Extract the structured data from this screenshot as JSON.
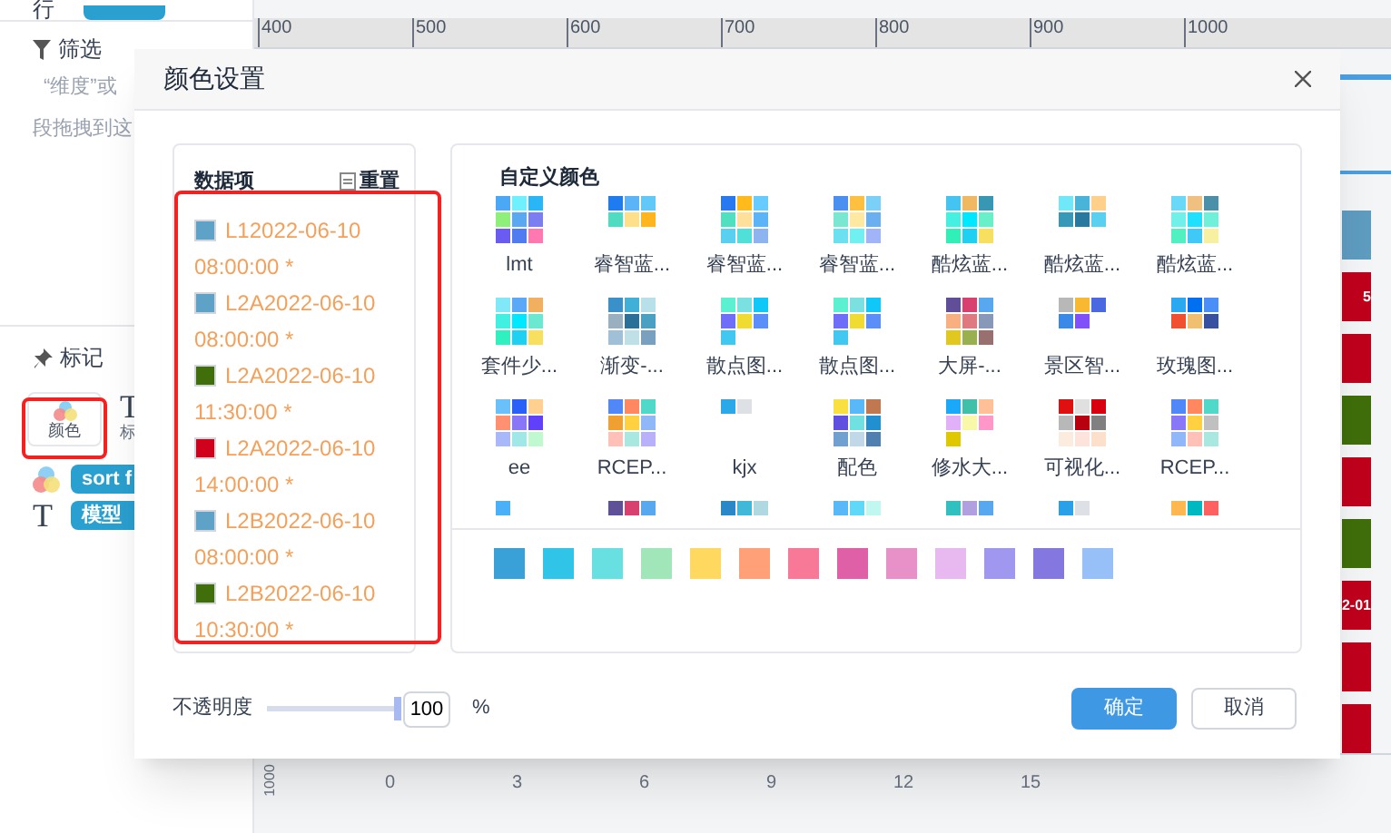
{
  "sidebar": {
    "row_label": "行",
    "filter_title": "筛选",
    "filter_hint_1": "“维度”或",
    "filter_hint_2": "段拖拽到这",
    "marks_title": "标记",
    "color_button": "颜色",
    "label_icon": "T",
    "label_button": "标",
    "mark_fields": [
      {
        "kind": "color",
        "tag": "sort f"
      },
      {
        "kind": "text",
        "icon": "T",
        "tag": "模型"
      }
    ]
  },
  "canvas": {
    "ruler": [
      "400",
      "500",
      "600",
      "700",
      "800",
      "900",
      "1000"
    ],
    "bar_texts": [
      "5",
      "2-01"
    ],
    "x_ticks": [
      "0",
      "3",
      "6",
      "9",
      "12",
      "15"
    ],
    "y_tick": "1000"
  },
  "dialog": {
    "title": "颜色设置",
    "data_items": {
      "title": "数据项",
      "reset": "重置",
      "items": [
        {
          "label": "L12022-06-10 08:00:00 *",
          "color": "#5ea2c8"
        },
        {
          "label": "L2A2022-06-10 08:00:00 *",
          "color": "#5ea2c8"
        },
        {
          "label": "L2A2022-06-10 11:30:00 *",
          "color": "#3f6e0a"
        },
        {
          "label": "L2A2022-06-10 14:00:00 *",
          "color": "#d0021b"
        },
        {
          "label": "L2B2022-06-10 08:00:00 *",
          "color": "#5ea2c8"
        },
        {
          "label": "L2B2022-06-10 10:30:00 *",
          "color": "#3f6e0a"
        }
      ]
    },
    "custom_colors": {
      "title": "自定义颜色",
      "palettes": [
        {
          "name": "lmt",
          "swatches": [
            {
              "color": "#4aa8f5"
            },
            {
              "color": "#6ff0ff"
            },
            {
              "color": "#29b6f6"
            },
            {
              "color": "#8ef07a"
            },
            {
              "color": "#5aa8f0"
            },
            {
              "color": "#7a7ef0"
            },
            {
              "color": "#6a5cf0"
            },
            {
              "color": "#4f7cf0"
            },
            {
              "color": "#ff78b0"
            }
          ]
        },
        {
          "name": "睿智蓝...",
          "swatches": [
            {
              "color": "#1e7cf0"
            },
            {
              "color": "#5ab4f7"
            },
            {
              "color": "#62c8f7"
            },
            {
              "color": "#4fdcc0"
            },
            {
              "color": "#ffe08a"
            },
            {
              "color": "#ffb51e"
            }
          ]
        },
        {
          "name": "睿智蓝...",
          "swatches": [
            {
              "color": "#2878f0"
            },
            {
              "color": "#ffbb1c"
            },
            {
              "color": "#66ccff"
            },
            {
              "color": "#50e0c0"
            },
            {
              "color": "#ffe09a"
            },
            {
              "color": "#5ab4f7"
            },
            {
              "color": "#5ad0f0"
            },
            {
              "color": "#50e0d8"
            },
            {
              "color": "#8eb4f0"
            }
          ]
        },
        {
          "name": "睿智蓝...",
          "swatches": [
            {
              "color": "#4a90f0"
            },
            {
              "color": "#ffc040"
            },
            {
              "color": "#7ad0f7"
            },
            {
              "color": "#7ae8d0"
            },
            {
              "color": "#ffe8a0"
            },
            {
              "color": "#6ab0f0"
            },
            {
              "color": "#6ae0f0"
            },
            {
              "color": "#70f0f0"
            },
            {
              "color": "#a0b4f7"
            }
          ]
        },
        {
          "name": "酷炫蓝...",
          "swatches": [
            {
              "color": "#44c4f0"
            },
            {
              "color": "#f0b860"
            },
            {
              "color": "#3898b4"
            },
            {
              "color": "#44f0e0"
            },
            {
              "color": "#00e8ff"
            },
            {
              "color": "#6af0c8"
            },
            {
              "color": "#30f0b8"
            },
            {
              "color": "#20d0f0"
            },
            {
              "color": "#f7e060"
            }
          ]
        },
        {
          "name": "酷炫蓝...",
          "swatches": [
            {
              "color": "#70e8f7"
            },
            {
              "color": "#4ab4d8"
            },
            {
              "color": "#ffd08a"
            },
            {
              "color": "#3898b8"
            },
            {
              "color": "#2878a0"
            },
            {
              "color": "#5ad0f0"
            }
          ]
        },
        {
          "name": "酷炫蓝...",
          "swatches": [
            {
              "color": "#6ad8f7"
            },
            {
              "color": "#f0c080"
            },
            {
              "color": "#4a90a8"
            },
            {
              "color": "#70f0e8"
            },
            {
              "color": "#20e0ff"
            },
            {
              "color": "#70f0d8"
            },
            {
              "color": "#50f0c0"
            },
            {
              "color": "#40c8f7"
            },
            {
              "color": "#f7f0a0"
            }
          ]
        },
        {
          "name": "套件少...",
          "swatches": [
            {
              "color": "#80e8f7"
            },
            {
              "color": "#5aa8f8"
            },
            {
              "color": "#f0b060"
            },
            {
              "color": "#40f0e0"
            },
            {
              "color": "#00e8ff"
            },
            {
              "color": "#6ae8d0"
            },
            {
              "color": "#30f0c0"
            },
            {
              "color": "#20d0f0"
            },
            {
              "color": "#f7e060"
            }
          ]
        },
        {
          "name": "渐变-...",
          "swatches": [
            {
              "color": "#3a90c8"
            },
            {
              "color": "#40b0d8"
            },
            {
              "color": "#b8e0e8"
            },
            {
              "color": "#98b0c0"
            },
            {
              "color": "#2a7098"
            },
            {
              "color": "#4aa0c0"
            },
            {
              "color": "#a0c0d8"
            },
            {
              "color": "#c0e0e8"
            },
            {
              "color": "#7aa0c0"
            }
          ]
        },
        {
          "name": "散点图...",
          "swatches": [
            {
              "color": "#5af0d0"
            },
            {
              "color": "#7ae0e0"
            },
            {
              "color": "#10c8f8"
            },
            {
              "color": "#6e6ef8"
            },
            {
              "color": "#f0dc30"
            },
            {
              "color": "#5a8ef8"
            },
            {
              "color": "#40c8f0"
            }
          ]
        },
        {
          "name": "散点图...",
          "swatches": [
            {
              "color": "#5af0d0"
            },
            {
              "color": "#7ae0e0"
            },
            {
              "color": "#10c8f8"
            },
            {
              "color": "#6e6ef8"
            },
            {
              "color": "#f0dc30"
            },
            {
              "color": "#5a8ef8"
            },
            {
              "color": "#40c8f0"
            }
          ]
        },
        {
          "name": "大屏-...",
          "swatches": [
            {
              "color": "#604f98"
            },
            {
              "color": "#d84070"
            },
            {
              "color": "#58a8f0"
            },
            {
              "color": "#f8b080"
            },
            {
              "color": "#e07880"
            },
            {
              "color": "#8898b8"
            },
            {
              "color": "#e0c820"
            },
            {
              "color": "#98b050"
            },
            {
              "color": "#987070"
            }
          ]
        },
        {
          "name": "景区智...",
          "swatches": [
            {
              "color": "#b8b8b8"
            },
            {
              "color": "#f8b830"
            },
            {
              "color": "#4a68e0"
            },
            {
              "color": "#3a88e8"
            },
            {
              "color": "#8050f8"
            }
          ]
        },
        {
          "name": "玫瑰图...",
          "swatches": [
            {
              "color": "#2aa8f0"
            },
            {
              "color": "#0070f0"
            },
            {
              "color": "#4a8ef8"
            },
            {
              "color": "#f05030"
            },
            {
              "color": "#f0c070"
            },
            {
              "color": "#3850a0"
            }
          ]
        },
        {
          "name": "ee",
          "swatches": [
            {
              "color": "#6ac0f8"
            },
            {
              "color": "#2860f8"
            },
            {
              "color": "#ffd090"
            },
            {
              "color": "#ff9070"
            },
            {
              "color": "#8878f8"
            },
            {
              "color": "#6040f8"
            },
            {
              "color": "#a8b8f8"
            },
            {
              "color": "#a0e8e8"
            },
            {
              "color": "#c0f8d0"
            }
          ]
        },
        {
          "name": "RCEP...",
          "swatches": [
            {
              "color": "#5088f8"
            },
            {
              "color": "#ff8860"
            },
            {
              "color": "#50d8c8"
            },
            {
              "color": "#f0a030"
            },
            {
              "color": "#ffd040"
            },
            {
              "color": "#90b8f8"
            },
            {
              "color": "#ffc0b8"
            },
            {
              "color": "#a8e8e0"
            },
            {
              "color": "#b8b0f8"
            }
          ]
        },
        {
          "name": "kjx",
          "swatches": [
            {
              "color": "#2aa8e8"
            },
            {
              "color": "#dde0e4"
            }
          ]
        },
        {
          "name": "配色",
          "swatches": [
            {
              "color": "#f7e040"
            },
            {
              "color": "#58b8f8"
            },
            {
              "color": "#c07850"
            },
            {
              "color": "#6050e0"
            },
            {
              "color": "#70e0e0"
            },
            {
              "color": "#2090d0"
            },
            {
              "color": "#70a0d0"
            },
            {
              "color": "#c0d8e8"
            },
            {
              "color": "#5080b0"
            }
          ]
        },
        {
          "name": "修水大...",
          "swatches": [
            {
              "color": "#1aa8f8"
            },
            {
              "color": "#40c0a8"
            },
            {
              "color": "#ffc098"
            },
            {
              "color": "#e0b0f8"
            },
            {
              "color": "#f8f8a8"
            },
            {
              "color": "#ff98c8"
            },
            {
              "color": "#e0c800"
            }
          ]
        },
        {
          "name": "可视化...",
          "swatches": [
            {
              "color": "#e01010"
            },
            {
              "color": "#e0e0e0"
            },
            {
              "color": "#d80010"
            },
            {
              "color": "#b8b8b8"
            },
            {
              "color": "#b80010"
            },
            {
              "color": "#808080"
            },
            {
              "color": "#fcece0"
            },
            {
              "color": "#fce4dc"
            },
            {
              "color": "#fce0cc"
            }
          ]
        },
        {
          "name": "RCEP...",
          "swatches": [
            {
              "color": "#5088f8"
            },
            {
              "color": "#ff8860"
            },
            {
              "color": "#50d8c8"
            },
            {
              "color": "#8878f8"
            },
            {
              "color": "#ffd040"
            },
            {
              "color": "#c0c0c0"
            },
            {
              "color": "#90b8f8"
            },
            {
              "color": "#ffc0b8"
            },
            {
              "color": "#a8e8e0"
            }
          ]
        },
        {
          "swatches": [
            {
              "color": "#4ab0f8"
            }
          ]
        },
        {
          "swatches": [
            {
              "color": "#605098"
            },
            {
              "color": "#d84070"
            },
            {
              "color": "#58a8f0"
            }
          ]
        },
        {
          "swatches": [
            {
              "color": "#2a88c8"
            },
            {
              "color": "#40b8d8"
            },
            {
              "color": "#b0d8e0"
            }
          ]
        },
        {
          "swatches": [
            {
              "color": "#58b8f8"
            },
            {
              "color": "#60d8f8"
            },
            {
              "color": "#c0f8f0"
            }
          ]
        },
        {
          "swatches": [
            {
              "color": "#30c0c0"
            },
            {
              "color": "#b0a0e0"
            },
            {
              "color": "#58a8f0"
            }
          ]
        },
        {
          "swatches": [
            {
              "color": "#2aa0e8"
            },
            {
              "color": "#dde0e4"
            }
          ]
        },
        {
          "swatches": [
            {
              "color": "#ffb850"
            },
            {
              "color": "#00b8c0"
            },
            {
              "color": "#ff6060"
            }
          ]
        }
      ]
    },
    "basic_colors": [
      {
        "color": "#3aa0d8"
      },
      {
        "color": "#30c4e8"
      },
      {
        "color": "#68dfe0"
      },
      {
        "color": "#a0e6b8"
      },
      {
        "color": "#ffd860"
      },
      {
        "color": "#ffa078"
      },
      {
        "color": "#f87898"
      },
      {
        "color": "#e060a8"
      },
      {
        "color": "#e890c8"
      },
      {
        "color": "#e8b8f0"
      },
      {
        "color": "#a098f0"
      },
      {
        "color": "#8478e0"
      },
      {
        "color": "#98c0f8"
      }
    ],
    "opacity": {
      "label": "不透明度",
      "level": 1,
      "value": "100",
      "unit": "%"
    },
    "buttons": [
      {
        "label": "确定",
        "kind": "primary"
      },
      {
        "label": "取消",
        "kind": "default"
      }
    ]
  }
}
